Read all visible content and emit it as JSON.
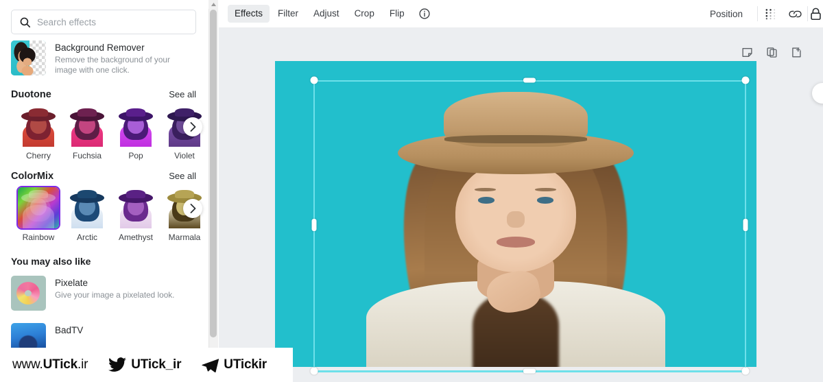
{
  "app": {
    "accent": "#22bfcc",
    "purple": "#7d2ae8"
  },
  "search": {
    "placeholder": "Search effects",
    "value": "",
    "icon": "search-icon"
  },
  "background_remover": {
    "title": "Background Remover",
    "description": "Remove the background of your image with one click."
  },
  "sections": [
    {
      "title": "Duotone",
      "see_all": "See all",
      "items": [
        {
          "label": "Cherry",
          "selected": false
        },
        {
          "label": "Fuchsia",
          "selected": false
        },
        {
          "label": "Pop",
          "selected": false
        },
        {
          "label": "Violet",
          "selected": false
        }
      ]
    },
    {
      "title": "ColorMix",
      "see_all": "See all",
      "items": [
        {
          "label": "Rainbow",
          "selected": true
        },
        {
          "label": "Arctic",
          "selected": false
        },
        {
          "label": "Amethyst",
          "selected": false
        },
        {
          "label": "Marmala",
          "selected": false
        }
      ]
    }
  ],
  "also_like": {
    "title": "You may also like",
    "items": [
      {
        "title": "Pixelate",
        "description": "Give your image a pixelated look."
      },
      {
        "title": "BadTV",
        "description": ""
      }
    ]
  },
  "toolbar": {
    "tabs": [
      {
        "label": "Effects",
        "active": true
      },
      {
        "label": "Filter",
        "active": false
      },
      {
        "label": "Adjust",
        "active": false
      },
      {
        "label": "Crop",
        "active": false
      },
      {
        "label": "Flip",
        "active": false
      }
    ],
    "info_icon": "info-icon",
    "position_label": "Position",
    "transparency_icon": "transparency-icon",
    "link_icon": "link-icon",
    "lock_icon": "lock-icon"
  },
  "object_toolbar": {
    "comment_icon": "comment-icon",
    "duplicate_icon": "duplicate-icon",
    "share_icon": "share-icon"
  },
  "watermark": {
    "site": {
      "prefix": "www.",
      "name": "UTick",
      "suffix": ".ir"
    },
    "twitter": {
      "icon": "twitter-icon",
      "handle": "UTick_ir"
    },
    "telegram": {
      "icon": "telegram-icon",
      "handle": "UTickir"
    }
  }
}
